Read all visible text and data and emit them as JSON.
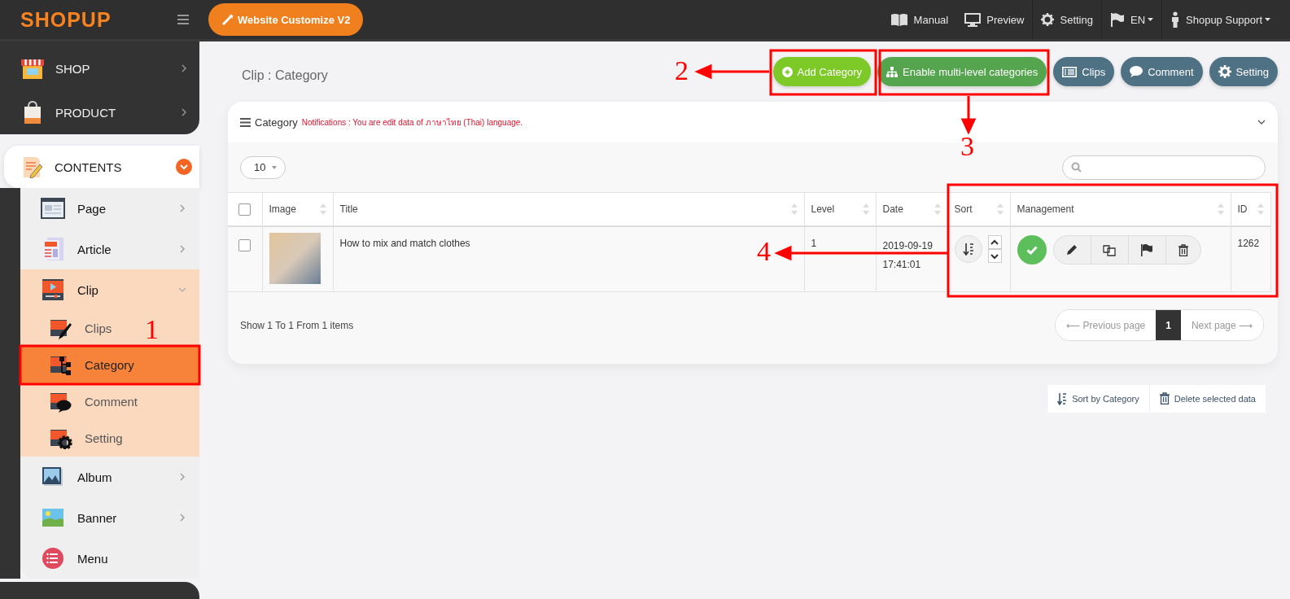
{
  "header": {
    "logo": "SHOPUP",
    "customize_button": "Website Customize V2",
    "links": [
      {
        "label": "Manual",
        "dropdown": false
      },
      {
        "label": "Preview",
        "dropdown": false
      },
      {
        "label": "Setting",
        "dropdown": false
      },
      {
        "label": "EN",
        "dropdown": true
      },
      {
        "label": "Shopup Support",
        "dropdown": true
      }
    ]
  },
  "sidebar": {
    "top_items": [
      {
        "label": "SHOP",
        "expanded": false
      },
      {
        "label": "PRODUCT",
        "expanded": false
      },
      {
        "label": "CONTENTS",
        "expanded": true
      }
    ],
    "content_items": [
      {
        "label": "Page",
        "expandable": true,
        "expanded": false
      },
      {
        "label": "Article",
        "expandable": true,
        "expanded": false
      },
      {
        "label": "Clip",
        "expandable": true,
        "expanded": true,
        "children": [
          {
            "label": "Clips",
            "selected": false
          },
          {
            "label": "Category",
            "selected": true
          },
          {
            "label": "Comment",
            "selected": false
          },
          {
            "label": "Setting",
            "selected": false
          }
        ]
      },
      {
        "label": "Album",
        "expandable": true,
        "expanded": false
      },
      {
        "label": "Banner",
        "expandable": true,
        "expanded": false
      },
      {
        "label": "Menu",
        "expandable": false,
        "expanded": false
      }
    ]
  },
  "page_title": "Clip : Category",
  "actions": [
    {
      "label": "Add Category",
      "kind": "add"
    },
    {
      "label": "Enable multi-level categories",
      "kind": "multilevel"
    },
    {
      "label": "Clips",
      "kind": "nav"
    },
    {
      "label": "Comment",
      "kind": "nav"
    },
    {
      "label": "Setting",
      "kind": "nav"
    }
  ],
  "panel": {
    "title": "Category",
    "notice": "Notifications : You are edit data of ภาษาไทย (Thai) language.",
    "page_size": "10"
  },
  "table": {
    "all_checked": false,
    "columns": [
      {
        "label": "Image",
        "sortable": true
      },
      {
        "label": "Title",
        "sortable": true
      },
      {
        "label": "Level",
        "sortable": true
      },
      {
        "label": "Date",
        "sortable": true
      },
      {
        "label": "Sort",
        "sortable": true
      },
      {
        "label": "Management",
        "sortable": true
      },
      {
        "label": "ID",
        "sortable": true
      }
    ],
    "rows": [
      {
        "checked": false,
        "title": "How to mix and match clothes",
        "level": "1",
        "date": "2019-09-19",
        "time": "17:41:01",
        "published": true,
        "id": "1262"
      }
    ]
  },
  "footer": {
    "summary": "Show 1 To 1 From 1 items",
    "previous": "⟵ Previous page",
    "pages": [
      {
        "label": "1",
        "selected": true
      }
    ],
    "next": "Next page ⟶"
  },
  "bulk_actions": [
    {
      "label": "Sort by Category"
    },
    {
      "label": "Delete selected data"
    }
  ],
  "annotations": [
    {
      "label": "1"
    },
    {
      "label": "2"
    },
    {
      "label": "3"
    },
    {
      "label": "4"
    }
  ]
}
